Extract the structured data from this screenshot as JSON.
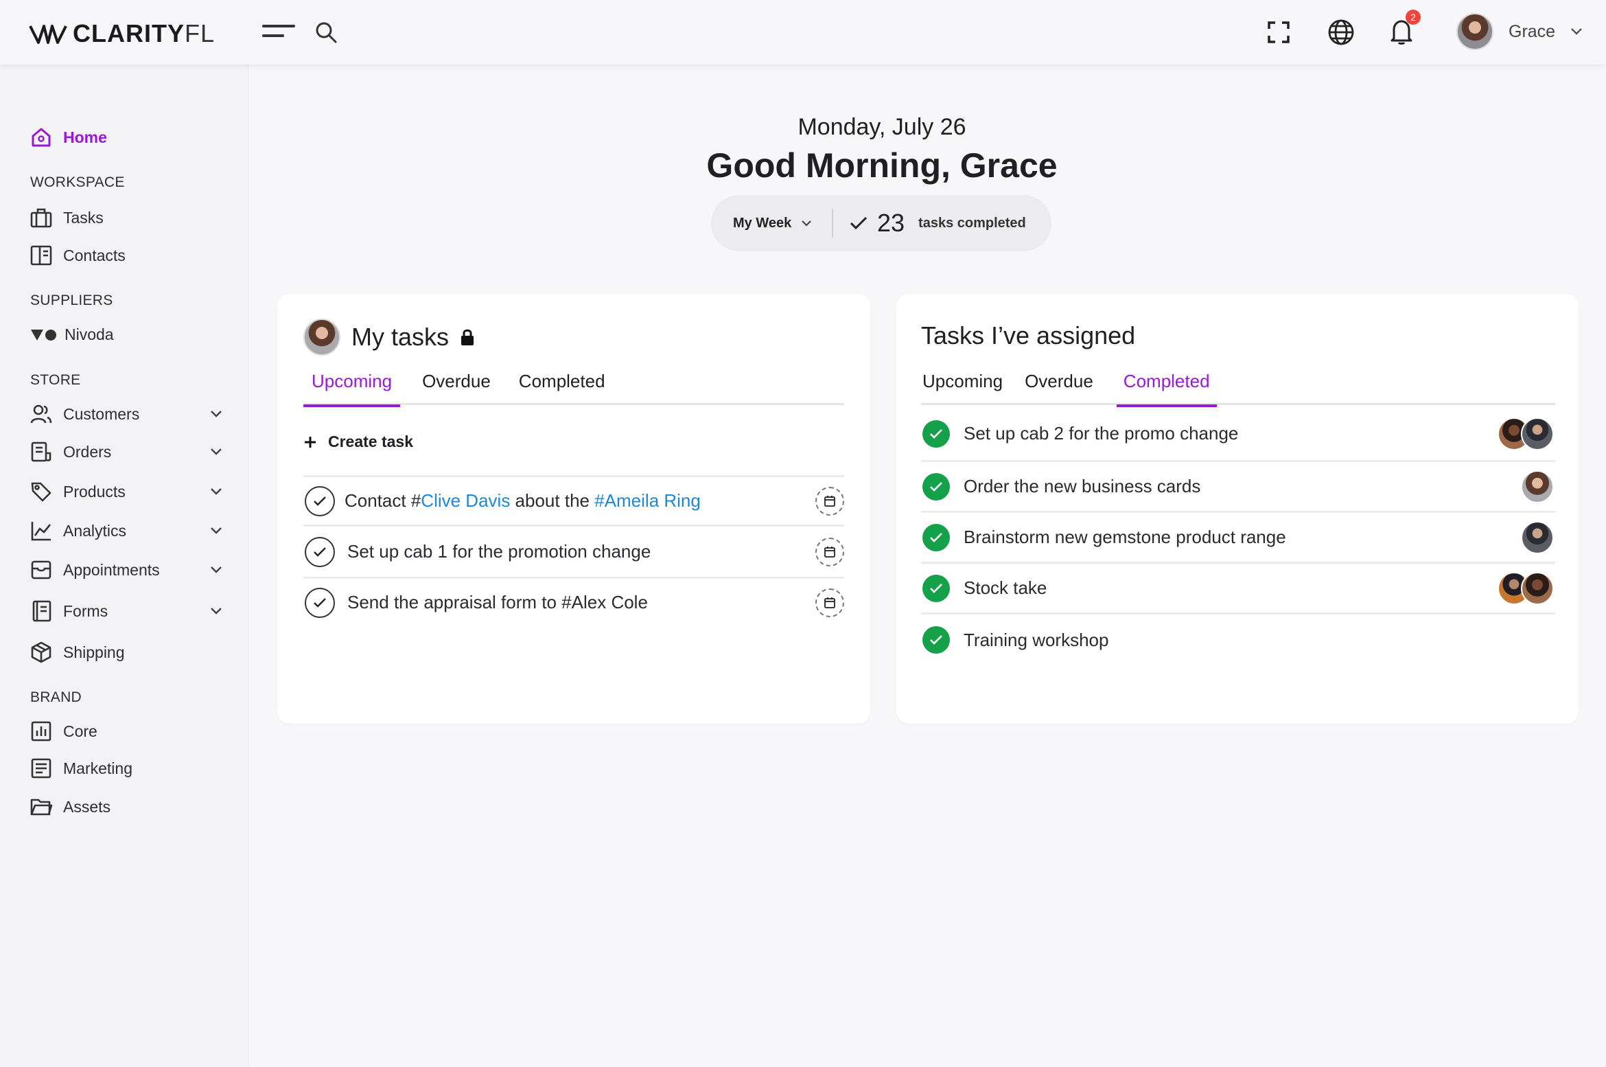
{
  "brand": {
    "name_bold": "CLARITY",
    "name_light": "FL"
  },
  "topbar": {
    "notifications_count": "2",
    "user_name": "Grace"
  },
  "sidebar": {
    "home": "Home",
    "sections": {
      "workspace": "WORKSPACE",
      "suppliers": "SUPPLIERS",
      "store": "STORE",
      "brand": "BRAND"
    },
    "workspace_items": [
      "Tasks",
      "Contacts"
    ],
    "supplier_items": [
      "Nivoda"
    ],
    "store_items": [
      "Customers",
      "Orders",
      "Products",
      "Analytics",
      "Appointments",
      "Forms",
      "Shipping"
    ],
    "brand_items": [
      "Core",
      "Marketing",
      "Assets"
    ]
  },
  "header": {
    "date": "Monday, July 26",
    "greeting": "Good Morning, Grace",
    "period": "My Week",
    "completed_count": "23",
    "completed_label": "tasks completed"
  },
  "my_tasks": {
    "title": "My tasks",
    "tabs": [
      "Upcoming",
      "Overdue",
      "Completed"
    ],
    "active_tab": "Upcoming",
    "create_label": "Create task",
    "row1": {
      "pre": "Contact #",
      "contact": "Clive Davis",
      "mid": " about the ",
      "product": "#Ameila Ring"
    },
    "row2": "Set up cab 1 for the promotion change",
    "row3": "Send the appraisal form to #Alex Cole"
  },
  "assigned": {
    "title": "Tasks I’ve assigned",
    "tabs": [
      "Upcoming",
      "Overdue",
      "Completed"
    ],
    "active_tab": "Completed",
    "items": [
      "Set up cab 2 for the promo change",
      "Order the new business cards",
      "Brainstorm new gemstone product range",
      "Stock take",
      "Training workshop"
    ]
  },
  "colors": {
    "accent": "#9a17d6",
    "link": "#1e88d6",
    "success": "#14a14a",
    "badge": "#f0453a"
  }
}
